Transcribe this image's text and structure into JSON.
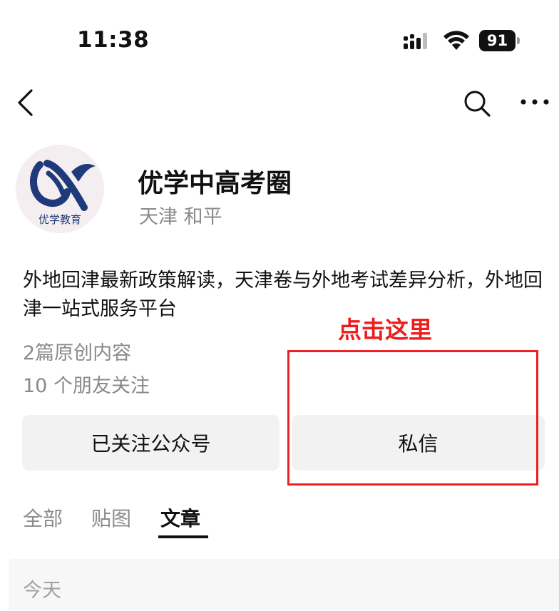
{
  "status_bar": {
    "time": "11:38",
    "battery_level": "91",
    "icons": [
      "signal-icon",
      "wifi-icon",
      "battery-icon"
    ]
  },
  "nav": {
    "icons": [
      "back-icon",
      "search-icon",
      "more-icon"
    ]
  },
  "profile": {
    "name": "优学中高考圈",
    "location": "天津 和平",
    "avatar_logo_text": "优学教育",
    "description": "外地回津最新政策解读，天津卷与外地考试差异分析，外地回津一站式服务平台",
    "original_count": "2篇原创内容",
    "friends_following": "10 个朋友关注"
  },
  "annotation": {
    "label": "点击这里",
    "color": "#ee1c1c"
  },
  "actions": {
    "followed_label": "已关注公众号",
    "message_label": "私信"
  },
  "tabs": [
    {
      "label": "全部",
      "active": false
    },
    {
      "label": "贴图",
      "active": false
    },
    {
      "label": "文章",
      "active": true
    }
  ],
  "feed": {
    "date_header": "今天"
  }
}
